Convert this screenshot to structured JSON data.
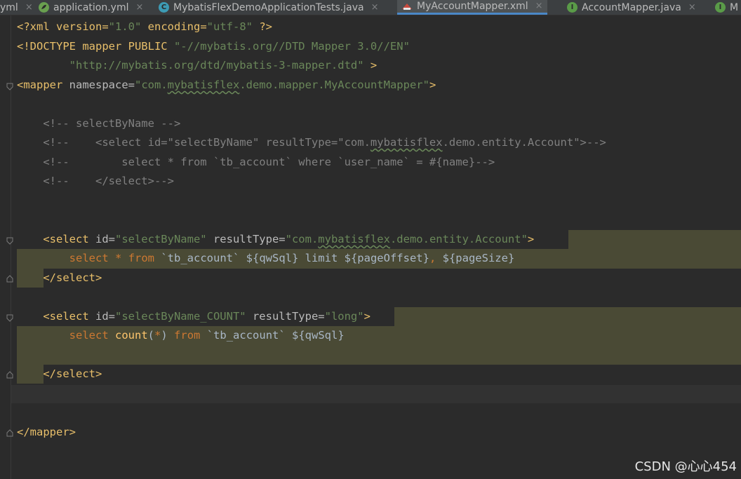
{
  "tabs": [
    {
      "label": "yml",
      "close": "×",
      "icon": "yaml-file-icon"
    },
    {
      "label": "application.yml",
      "close": "×",
      "icon": "spring-yaml-icon"
    },
    {
      "label": "MybatisFlexDemoApplicationTests.java",
      "close": "×",
      "icon": "java-class-icon",
      "icon_text": "C"
    },
    {
      "label": "MyAccountMapper.xml",
      "close": "×",
      "icon": "xml-file-icon",
      "active": true
    },
    {
      "label": "AccountMapper.java",
      "close": "×",
      "icon": "java-interface-icon",
      "icon_text": "I"
    },
    {
      "label": "M",
      "icon": "java-interface-icon",
      "icon_text": "I"
    }
  ],
  "code": {
    "l1": {
      "a": "<?xml version=",
      "b": "\"1.0\"",
      "c": " encoding=",
      "d": "\"utf-8\"",
      "e": " ?>"
    },
    "l2": {
      "a": "<!DOCTYPE mapper PUBLIC ",
      "b": "\"-//mybatis.org//DTD Mapper 3.0//EN\""
    },
    "l3": {
      "a": "        ",
      "b": "\"http://mybatis.org/dtd/mybatis-3-mapper.dtd\"",
      "c": " >"
    },
    "l4": {
      "a": "<mapper",
      "b": " namespace=",
      "c": "\"com.",
      "d": "mybatisflex",
      "e": ".demo.mapper.MyAccountMapper\"",
      "f": ">"
    },
    "l6": "    <!-- selectByName -->",
    "l7a": "    <!--    <select id=\"selectByName\" resultType=\"com.",
    "l7b": "mybatisflex",
    "l7c": ".demo.entity.Account\">-->",
    "l8": "    <!--        select * from `tb_account` where `user_name` = #{name}-->",
    "l9": "    <!--    </select>-->",
    "l12": {
      "a": "    ",
      "b": "<select",
      "c": " id=",
      "d": "\"selectByName\"",
      "e": " resultType=",
      "f": "\"com.",
      "g": "mybatisflex",
      "h": ".demo.entity.Account\"",
      "i": ">"
    },
    "l13": {
      "a": "        ",
      "b": "select",
      "c": " ",
      "d": "*",
      "e": " ",
      "f": "from",
      "g": " `tb_account` ${qwSql} limit ${pageOffset}",
      "h": ",",
      "i": " ${pageSize}"
    },
    "l14": {
      "a": "    ",
      "b": "</select>"
    },
    "l16": {
      "a": "    ",
      "b": "<select",
      "c": " id=",
      "d": "\"selectByName_COUNT\"",
      "e": " resultType=",
      "f": "\"long\"",
      "g": ">"
    },
    "l17": {
      "a": "        ",
      "b": "select",
      "c": " ",
      "d": "count",
      "e": "(",
      "f": "*",
      "g": ")",
      "h": " ",
      "i": "from",
      "j": " `tb_account` ${qwSql}"
    },
    "l19": {
      "a": "    ",
      "b": "</select>"
    },
    "l22": "</mapper>"
  },
  "watermark": "CSDN @心心454",
  "colors": {
    "background": "#2b2b2b",
    "tag": "#e8bf6a",
    "string": "#6a8759",
    "comment": "#808080",
    "keyword": "#cc7832",
    "function": "#ffc66d",
    "highlight": "#4a4a35"
  }
}
